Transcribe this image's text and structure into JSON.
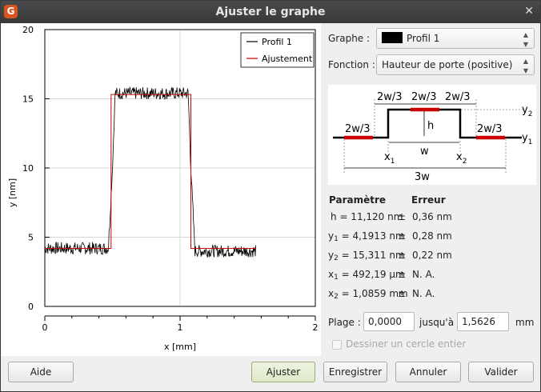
{
  "window": {
    "title": "Ajuster le graphe"
  },
  "chart_data": {
    "type": "line",
    "xlabel": "x [mm]",
    "ylabel": "y [nm]",
    "xlim": [
      0,
      2
    ],
    "ylim": [
      0,
      20
    ],
    "xticks": [
      "0",
      "1",
      "2"
    ],
    "yticks": [
      "0",
      "5",
      "10",
      "15",
      "20"
    ],
    "grid": true,
    "legend_position": "top-right",
    "series": [
      {
        "name": "Profil 1",
        "color": "#000000",
        "style": "noisy-profile",
        "x": [
          0.0,
          0.47,
          0.5,
          0.52,
          1.06,
          1.08,
          1.11,
          1.56
        ],
        "y": [
          4.2,
          4.2,
          10.0,
          15.4,
          15.4,
          10.0,
          4.0,
          4.0
        ]
      },
      {
        "name": "Ajustement",
        "color": "#cc0000",
        "style": "step",
        "x": [
          0.0,
          0.49,
          0.49,
          1.08,
          1.08,
          1.56
        ],
        "y": [
          4.19,
          4.19,
          15.31,
          15.31,
          4.19,
          4.19
        ]
      }
    ]
  },
  "panel": {
    "graph_label": "Graphe :",
    "graph_value": "Profil 1",
    "graph_swatch": "#000000",
    "function_label": "Fonction :",
    "function_value": "Hauteur de porte (positive)"
  },
  "diagram": {
    "labels": {
      "top_left": "2w/3",
      "top_mid": "2w/3",
      "top_right": "2w/3",
      "left_base": "2w/3",
      "right_base": "2w/3",
      "h": "h",
      "w": "w",
      "three_w": "3w",
      "y1": "y",
      "y1_sub": "1",
      "y2": "y",
      "y2_sub": "2",
      "x1": "x",
      "x1_sub": "1",
      "x2": "x",
      "x2_sub": "2"
    }
  },
  "params": {
    "header_param": "Paramètre",
    "header_error": "Erreur",
    "rows": [
      {
        "name": "h",
        "sub": "",
        "value": "= 11,120 nm",
        "pm": "±",
        "error": "0,36 nm"
      },
      {
        "name": "y",
        "sub": "1",
        "value": "= 4,1913 nm",
        "pm": "±",
        "error": "0,28 nm"
      },
      {
        "name": "y",
        "sub": "2",
        "value": "= 15,311 nm",
        "pm": "±",
        "error": "0,22 nm"
      },
      {
        "name": "x",
        "sub": "1",
        "value": "= 492,19 µm",
        "pm": "±",
        "error": "N. A."
      },
      {
        "name": "x",
        "sub": "2",
        "value": "= 1,0859 mm",
        "pm": "±",
        "error": "N. A."
      }
    ]
  },
  "range": {
    "label": "Plage :",
    "from": "0,0000",
    "to_label": "jusqu'à",
    "to": "1,5626",
    "unit": "mm"
  },
  "checkbox": {
    "label": "Dessiner un cercle entier",
    "checked": false,
    "enabled": false
  },
  "buttons": {
    "help": "Aide",
    "fit": "Ajuster",
    "save": "Enregistrer",
    "cancel": "Annuler",
    "ok": "Valider"
  }
}
